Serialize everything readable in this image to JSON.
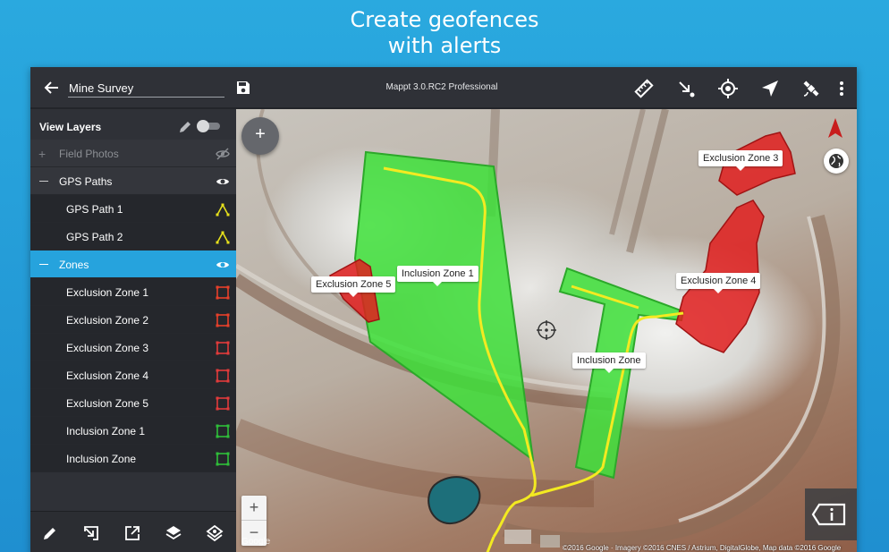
{
  "headline": {
    "line1": "Create geofences",
    "line2": "with alerts"
  },
  "toolbar": {
    "project_name": "Mine Survey",
    "app_title": "Mappt 3.0.RC2 Professional",
    "icons": [
      "back-arrow-icon",
      "save-icon",
      "ruler-icon",
      "import-arrow-icon",
      "gps-locate-icon",
      "navigation-arrow-icon",
      "satellite-icon",
      "more-vert-icon"
    ]
  },
  "sidebar": {
    "title": "View Layers",
    "groups": {
      "field_photos": {
        "label": "Field Photos",
        "visible": false
      },
      "gps_paths": {
        "label": "GPS Paths"
      },
      "zones": {
        "label": "Zones"
      }
    },
    "gps_items": [
      {
        "label": "GPS Path 1",
        "color": "#e8e21c"
      },
      {
        "label": "GPS Path 2",
        "color": "#e8e21c"
      }
    ],
    "zone_items": [
      {
        "label": "Exclusion Zone 1",
        "color": "#e8402a"
      },
      {
        "label": "Exclusion Zone 2",
        "color": "#e8402a"
      },
      {
        "label": "Exclusion Zone 3",
        "color": "#e23b3b"
      },
      {
        "label": "Exclusion Zone 4",
        "color": "#e23b3b"
      },
      {
        "label": "Exclusion Zone 5",
        "color": "#e23b3b"
      },
      {
        "label": "Inclusion Zone 1",
        "color": "#2fbf3a"
      },
      {
        "label": "Inclusion Zone",
        "color": "#2fbf3a"
      }
    ],
    "bottom_icons": [
      "edit-pencil-icon",
      "import-icon",
      "export-icon",
      "layers-icon",
      "layer-settings-icon"
    ]
  },
  "map": {
    "labels": {
      "ez3": "Exclusion Zone 3",
      "ez4": "Exclusion Zone 4",
      "ez5": "Exclusion Zone 5",
      "iz1": "Inclusion Zone 1",
      "iz": "Inclusion Zone"
    },
    "fab": "+",
    "zoom_in": "+",
    "zoom_out": "−",
    "google_logo": "Google",
    "attribution": "©2016 Google · Imagery ©2016 CNES / Astrium, DigitalGlobe, Map data ©2016 Google",
    "colors": {
      "inclusion": "#3ee03a",
      "exclusion": "#e01e1e",
      "gps": "#f3ea21",
      "accent": "#26a3dd"
    }
  }
}
